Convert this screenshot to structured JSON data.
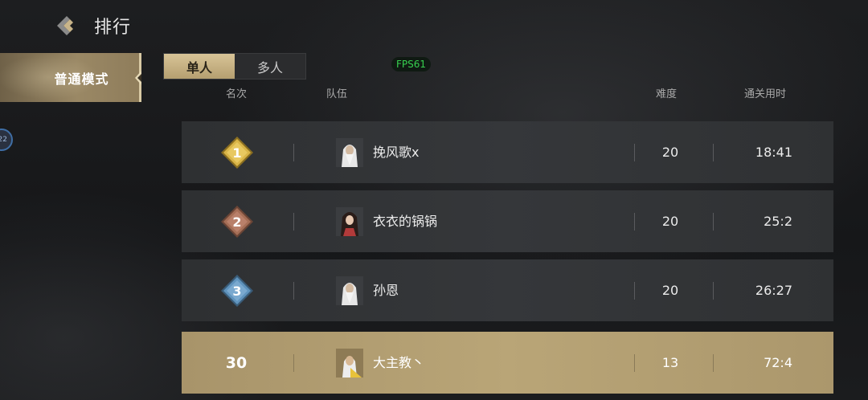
{
  "header": {
    "title": "排行",
    "back_icon": "back-chevron-icon"
  },
  "side_tabs": [
    {
      "label": "普通模式",
      "selected": true
    }
  ],
  "side_avatar": {
    "text": "22"
  },
  "mode_toggle": [
    {
      "label": "单人",
      "selected": true
    },
    {
      "label": "多人",
      "selected": false
    }
  ],
  "fps_badge": "FPS61",
  "columns": {
    "rank": "名次",
    "team": "队伍",
    "difficulty": "难度",
    "time": "通关用时"
  },
  "rows": [
    {
      "rank": "1",
      "name": "挽风歌x",
      "difficulty": "20",
      "time": "18:41",
      "badge_color": "#d9b447",
      "avatar": "white-hair-elder-avatar-icon"
    },
    {
      "rank": "2",
      "name": "衣衣的锅锅",
      "difficulty": "20",
      "time": "25:2",
      "badge_color": "#a56e56",
      "avatar": "female-swordswoman-avatar-icon"
    },
    {
      "rank": "3",
      "name": "孙恩",
      "difficulty": "20",
      "time": "26:27",
      "badge_color": "#5f93bd",
      "avatar": "white-hair-elder-avatar-icon"
    }
  ],
  "my_row": {
    "rank": "30",
    "name": "大主教丶",
    "difficulty": "13",
    "time": "72:4",
    "avatar": "elder-monk-avatar-icon"
  },
  "colors": {
    "accent_gold": "#b9a577",
    "row_bg": "#333538",
    "fps_green": "#37d04f"
  }
}
